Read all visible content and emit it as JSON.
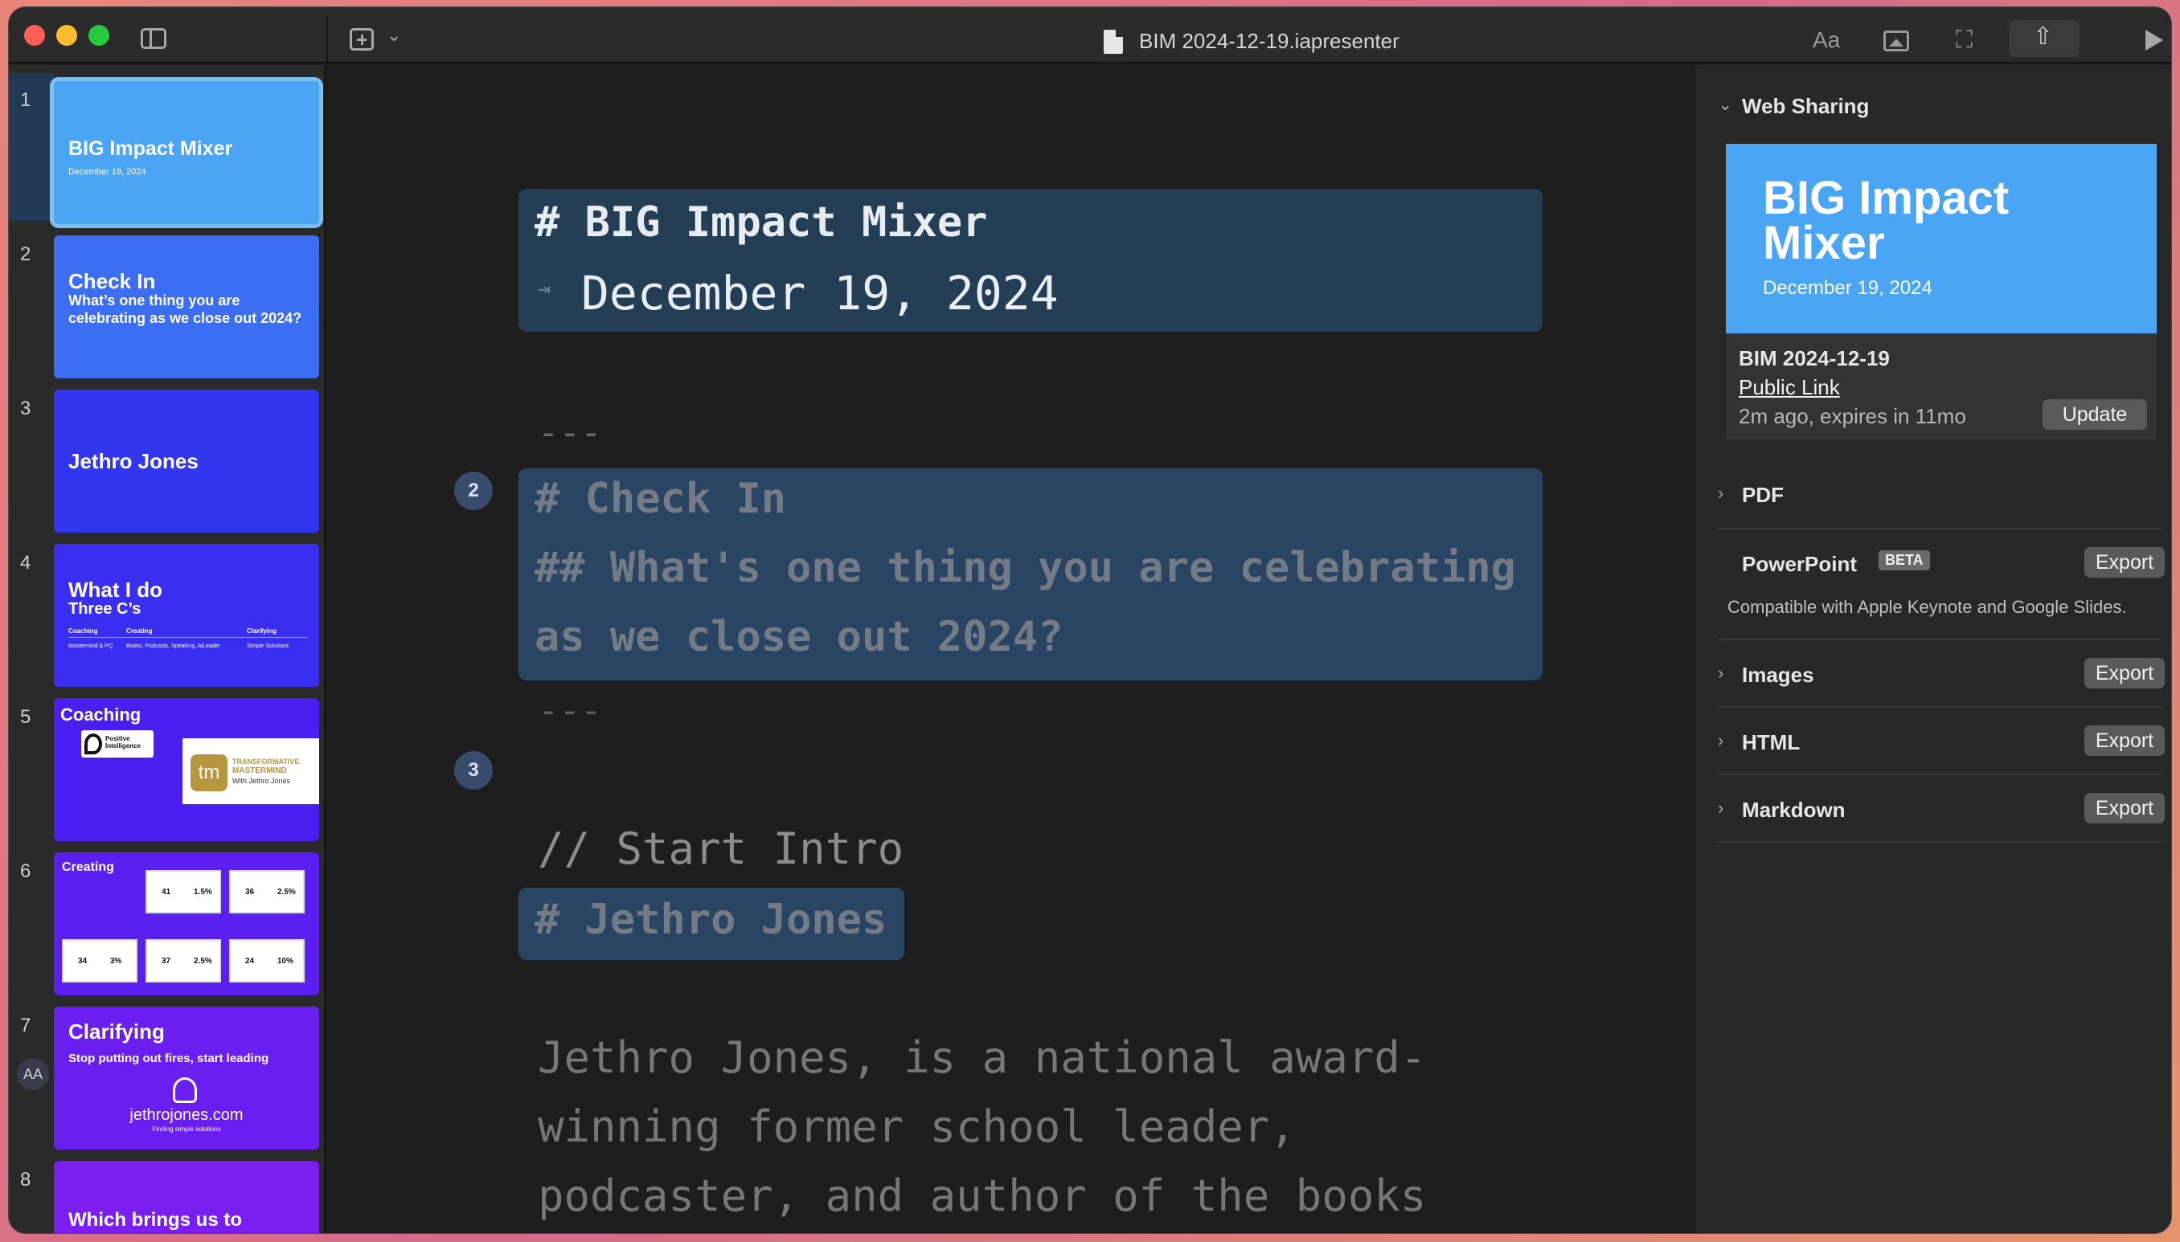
{
  "window": {
    "title": "BIM 2024-12-19.iapresenter"
  },
  "toolbar": {
    "font_label": "Aa"
  },
  "slides": [
    {
      "number": "1",
      "title": "BIG Impact Mixer",
      "subtitle": "December 19, 2024",
      "color": "#4aa6f5"
    },
    {
      "number": "2",
      "title": "Check In",
      "subtitle": "What’s one thing you are celebrating as we close out 2024?",
      "color": "#3b6ef2"
    },
    {
      "number": "3",
      "title": "Jethro Jones",
      "subtitle": "",
      "color": "#3236ef"
    },
    {
      "number": "4",
      "title": "What I do",
      "subtitle": "Three C’s",
      "color": "#3a2ff0",
      "table": {
        "headers": [
          "Coaching",
          "Creating",
          "Clarifying"
        ],
        "row": [
          "Mastermind & PQ",
          "Books, Podcasts, Speaking, AiLeader",
          "Simple Solutions"
        ]
      }
    },
    {
      "number": "5",
      "title": "Coaching",
      "subtitle": "",
      "color": "#4a1ff0",
      "logo_pq": "Positive Intelligence",
      "logo_tm_line1": "TRANSFORMATIVE",
      "logo_tm_line2": "MASTERMIND",
      "logo_tm_line3": "With Jethro Jones"
    },
    {
      "number": "6",
      "title": "Creating",
      "subtitle": "",
      "color": "#5b1ff0",
      "stats": [
        [
          "41",
          "1.5%"
        ],
        [
          "36",
          "2.5%"
        ],
        [
          "34",
          "3%"
        ],
        [
          "37",
          "2.5%"
        ],
        [
          "24",
          "10%"
        ]
      ]
    },
    {
      "number": "7",
      "title": "Clarifying",
      "subtitle": "Stop putting out fires, start leading",
      "color": "#6a1ff0",
      "site": "jethrojones.com",
      "tagline": "Finding simple solutions"
    },
    {
      "number": "8",
      "title": "Which brings us to",
      "subtitle": "",
      "color": "#7a1ff0"
    }
  ],
  "sidebar_badge": "AA",
  "editor": {
    "h1_title": "# BIG Impact Mixer",
    "indent_arrow": "⇥",
    "date": "December 19, 2024",
    "hr": "---",
    "badge2": "2",
    "badge3": "3",
    "checkin_h1": "# Check In",
    "checkin_h2_line1": "## What's one thing you are celebrating",
    "checkin_h2_line2": "as we close out 2024?",
    "comment": "// Start Intro",
    "jethro_h1": "# Jethro Jones",
    "para_line1": "Jethro Jones, is a national award-",
    "para_line2": "winning former school leader,",
    "para_line3": "podcaster, and author of the books"
  },
  "right_panel": {
    "web_sharing": {
      "label": "Web Sharing",
      "preview_title": "BIG Impact Mixer",
      "preview_date": "December 19, 2024",
      "doc_name": "BIM 2024-12-19",
      "link_label": "Public Link",
      "status": "2m ago, expires in 11mo",
      "update_label": "Update"
    },
    "pdf_label": "PDF",
    "powerpoint": {
      "label": "PowerPoint",
      "beta": "BETA",
      "export_label": "Export",
      "note": "Compatible with Apple Keynote and Google Slides."
    },
    "images": {
      "label": "Images",
      "export_label": "Export"
    },
    "html": {
      "label": "HTML",
      "export_label": "Export"
    },
    "markdown": {
      "label": "Markdown",
      "export_label": "Export"
    }
  }
}
